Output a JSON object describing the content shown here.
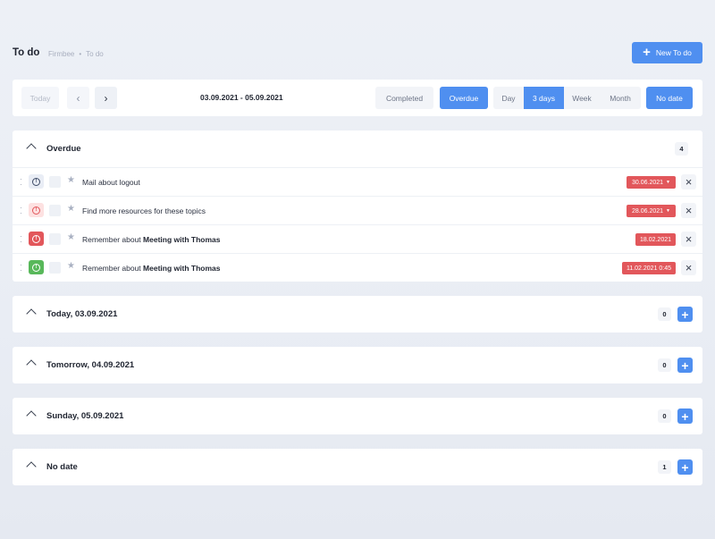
{
  "header": {
    "title": "To do",
    "breadcrumb": [
      "Firmbee",
      "•",
      "To do"
    ],
    "new_button": "New To do"
  },
  "toolbar": {
    "today": "Today",
    "prev_icon": "chevron-left-icon",
    "next_icon": "chevron-right-icon",
    "date_range": "03.09.2021 - 05.09.2021",
    "filters": {
      "completed": "Completed",
      "overdue": "Overdue",
      "selected": "Overdue"
    },
    "views": [
      "Day",
      "3 days",
      "Week",
      "Month"
    ],
    "selected_view": "3 days",
    "no_date": "No date"
  },
  "sections": [
    {
      "title": "Overdue",
      "count": "4",
      "tasks": [
        {
          "priority": "low",
          "text": "Mail about logout",
          "bold": "",
          "date": "30.06.2021",
          "has_caret": true
        },
        {
          "priority": "medium",
          "text": "Find more resources for these topics",
          "bold": "",
          "date": "28.06.2021",
          "has_caret": true
        },
        {
          "priority": "high",
          "text": "Remember about",
          "bold": "Meeting with Thomas",
          "date": "18.02.2021",
          "has_caret": false
        },
        {
          "priority": "done",
          "text": "Remember about",
          "bold": "Meeting with Thomas",
          "date": "11.02.2021 0:45",
          "has_caret": false
        }
      ]
    },
    {
      "title": "Today, 03.09.2021",
      "count": "0"
    },
    {
      "title": "Tomorrow, 04.09.2021",
      "count": "0"
    },
    {
      "title": "Sunday, 05.09.2021",
      "count": "0"
    },
    {
      "title": "No date",
      "count": "1"
    }
  ],
  "colors": {
    "accent": "#4f8ff0",
    "overdue_badge": "#e2575b",
    "priority_high": "#e2575b",
    "priority_medium_bg": "#fde1e1",
    "priority_done": "#58b85a",
    "background": "#eaeef5"
  }
}
